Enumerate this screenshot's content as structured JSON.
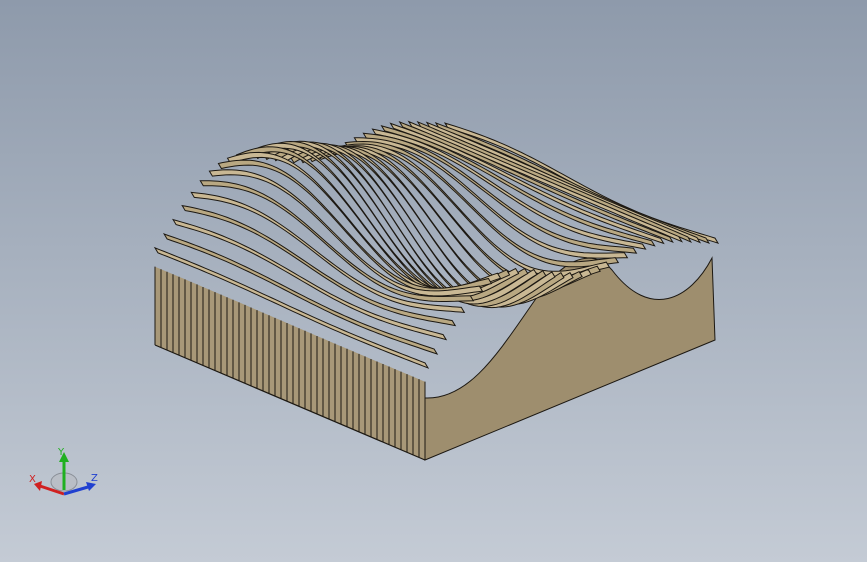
{
  "viewport": {
    "background_top": "#8e9aab",
    "background_bottom": "#c4cbd5"
  },
  "model": {
    "description_icon": "wave-surface-ribbed-block",
    "face_color": "#a89878",
    "top_color": "#c9b894",
    "edge_color": "#1c1812"
  },
  "triad": {
    "x_label": "X",
    "y_label": "Y",
    "z_label": "Z",
    "x_color": "#d02020",
    "y_color": "#20b020",
    "z_color": "#2040d0"
  }
}
